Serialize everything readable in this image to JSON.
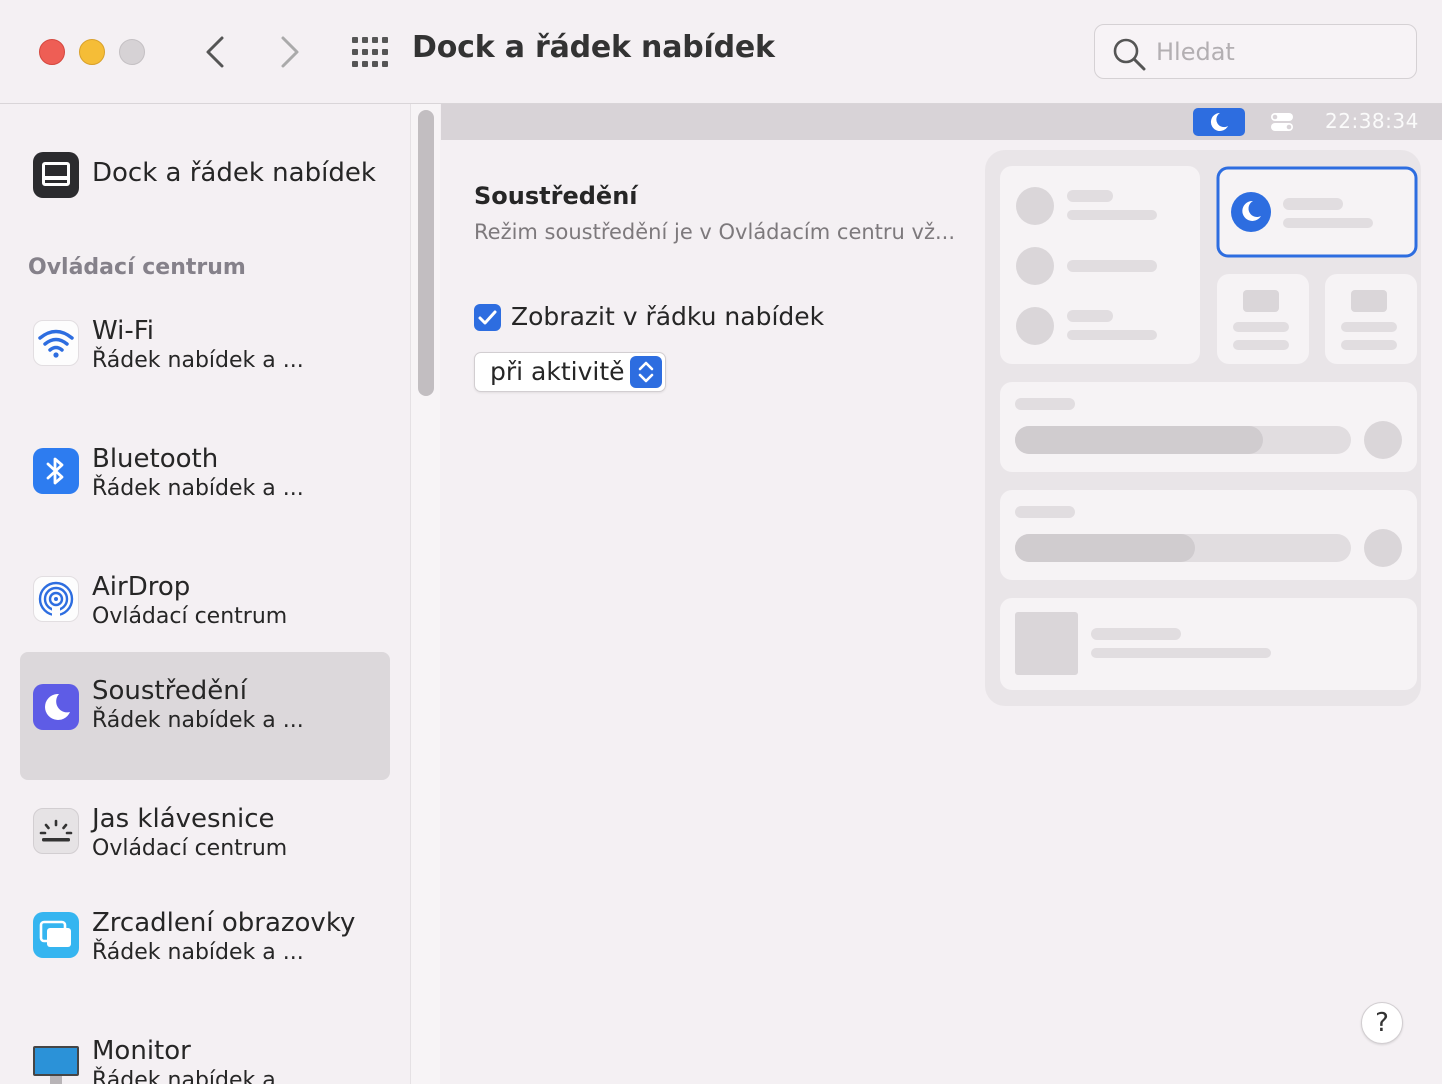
{
  "window": {
    "title": "Dock a řádek nabídek",
    "search_placeholder": "Hledat"
  },
  "toolbar": {
    "back_icon": "chevron-left-icon",
    "forward_icon": "chevron-right-icon",
    "grid_icon": "grid-icon"
  },
  "sidebar": {
    "top_item": {
      "label": "Dock a řádek nabídek",
      "icon": "dock-icon"
    },
    "section_header": "Ovládací centrum",
    "items": [
      {
        "title": "Wi-Fi",
        "subtitle": "Řádek nabídek a ...",
        "icon": "wifi-icon"
      },
      {
        "title": "Bluetooth",
        "subtitle": "Řádek nabídek a ...",
        "icon": "bluetooth-icon"
      },
      {
        "title": "AirDrop",
        "subtitle": "Ovládací centrum",
        "icon": "airdrop-icon"
      },
      {
        "title": "Soustředění",
        "subtitle": "Řádek nabídek a ...",
        "icon": "moon-icon",
        "selected": true
      },
      {
        "title": "Jas klávesnice",
        "subtitle": "Ovládací centrum",
        "icon": "keyboard-brightness-icon"
      },
      {
        "title": "Zrcadlení obrazovky",
        "subtitle": "Řádek nabídek a ...",
        "icon": "screen-mirroring-icon"
      },
      {
        "title": "Monitor",
        "subtitle": "Řádek nabídek a ...",
        "icon": "monitor-icon"
      }
    ]
  },
  "menubar_preview": {
    "time": "22:38:34"
  },
  "pane": {
    "title": "Soustředění",
    "description": "Režim soustředění je v Ovládacím centru vž...",
    "checkbox_label": "Zobrazit v řádku nabídek",
    "checkbox_checked": true,
    "popup_value": "při aktivitě"
  },
  "help_label": "?",
  "colors": {
    "accent": "#2d6de0",
    "close": "#ee5e55",
    "minimize": "#f5bd37",
    "focus_icon": "#5e5ce6"
  }
}
